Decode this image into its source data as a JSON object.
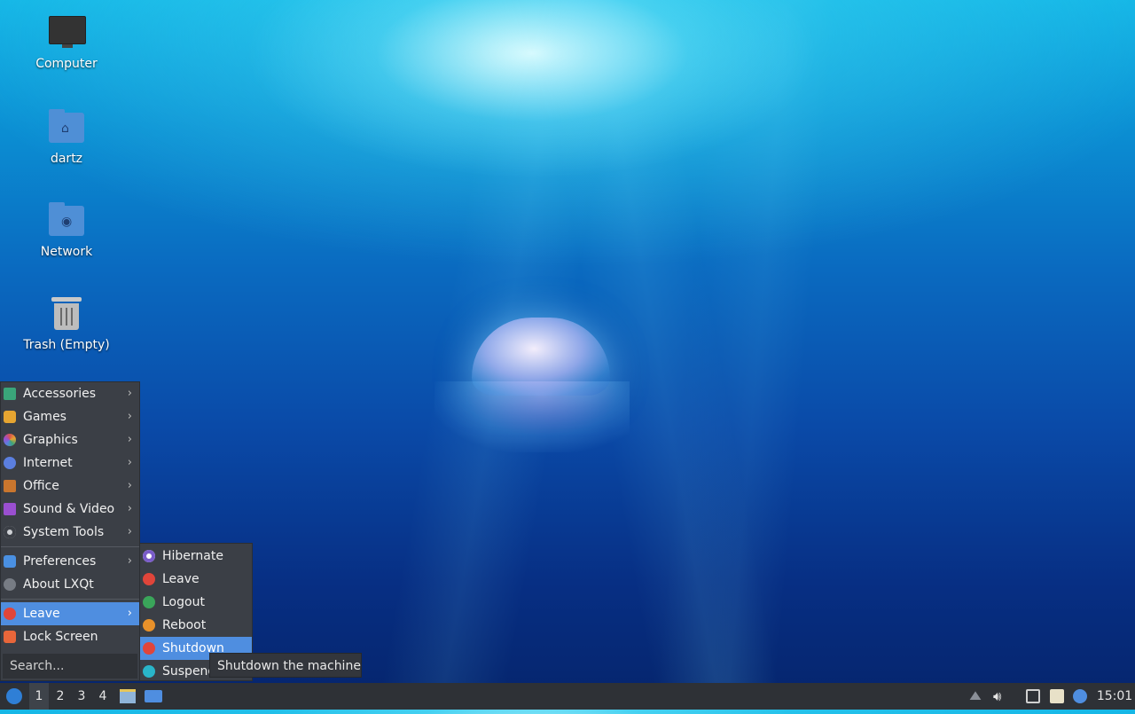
{
  "desktop": {
    "icons": [
      {
        "label": "Computer",
        "icon": "computer-icon"
      },
      {
        "label": "dartz",
        "icon": "home-folder-icon"
      },
      {
        "label": "Network",
        "icon": "network-folder-icon"
      },
      {
        "label": "Trash (Empty)",
        "icon": "trash-icon"
      }
    ]
  },
  "menu": {
    "categories": [
      {
        "label": "Accessories",
        "icon": "accessories-icon",
        "color": "#3aa57a"
      },
      {
        "label": "Games",
        "icon": "games-icon",
        "color": "#e6a531"
      },
      {
        "label": "Graphics",
        "icon": "graphics-icon",
        "color": "#d9534f"
      },
      {
        "label": "Internet",
        "icon": "internet-icon",
        "color": "#5b7fe0"
      },
      {
        "label": "Office",
        "icon": "office-icon",
        "color": "#c9762e"
      },
      {
        "label": "Sound & Video",
        "icon": "sound-video-icon",
        "color": "#9a4fd0"
      },
      {
        "label": "System Tools",
        "icon": "system-tools-icon",
        "color": "#8a8f98"
      }
    ],
    "preferences": {
      "label": "Preferences",
      "icon": "preferences-icon",
      "color": "#4a90e2"
    },
    "about": {
      "label": "About LXQt",
      "icon": "info-icon",
      "color": "#777c84"
    },
    "leave": {
      "label": "Leave",
      "icon": "power-icon",
      "color": "#e0453a"
    },
    "lock": {
      "label": "Lock Screen",
      "icon": "lock-icon",
      "color": "#e8663a"
    },
    "search_placeholder": "Search..."
  },
  "submenu": {
    "items": [
      {
        "label": "Hibernate",
        "icon": "hibernate-icon",
        "color": "#7a5cc9"
      },
      {
        "label": "Leave",
        "icon": "power-icon",
        "color": "#e0453a"
      },
      {
        "label": "Logout",
        "icon": "logout-icon",
        "color": "#3aa55a"
      },
      {
        "label": "Reboot",
        "icon": "reboot-icon",
        "color": "#e8912a"
      },
      {
        "label": "Shutdown",
        "icon": "power-icon",
        "color": "#e0453a"
      },
      {
        "label": "Suspend",
        "icon": "suspend-icon",
        "color": "#29b5c9"
      }
    ],
    "active_index": 4,
    "tooltip": "Shutdown the machine"
  },
  "taskbar": {
    "desktops": [
      "1",
      "2",
      "3",
      "4"
    ],
    "active_desktop": "1",
    "clock": "15:01"
  }
}
